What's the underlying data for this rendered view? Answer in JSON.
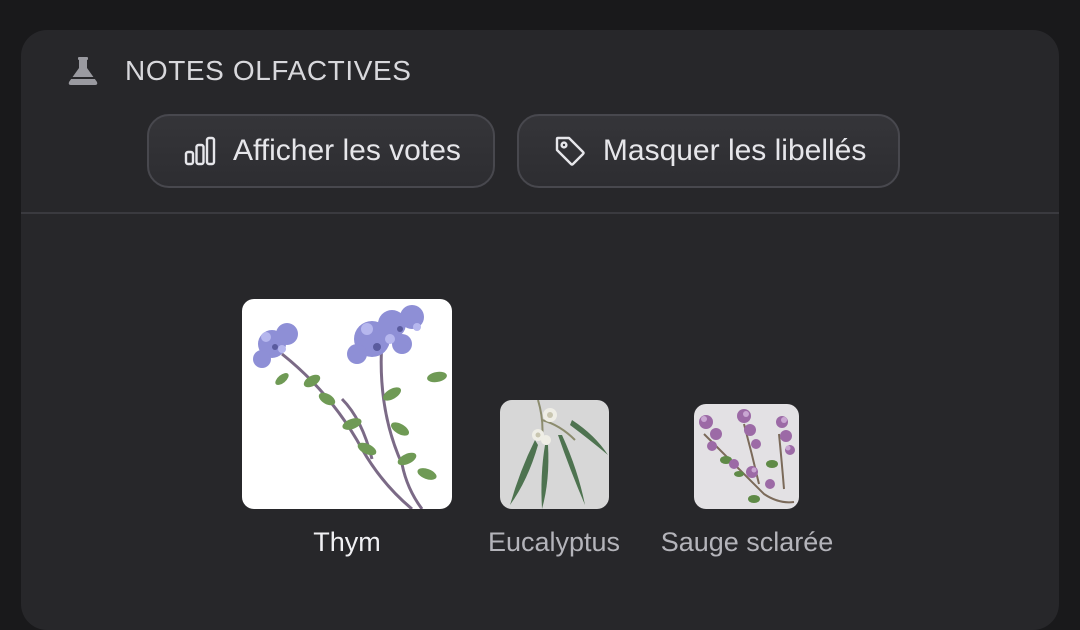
{
  "section": {
    "title": "NOTES OLFACTIVES",
    "icon": "flask-icon"
  },
  "toolbar": {
    "votes_label": "Afficher les votes",
    "votes_icon": "bar-chart-icon",
    "labels_label": "Masquer les libellés",
    "labels_icon": "tag-icon"
  },
  "notes": [
    {
      "label": "Thym",
      "image": "thyme-image",
      "emphasis": "primary"
    },
    {
      "label": "Eucalyptus",
      "image": "eucalyptus-image",
      "emphasis": "secondary"
    },
    {
      "label": "Sauge sclarée",
      "image": "clary-sage-image",
      "emphasis": "secondary"
    }
  ],
  "colors": {
    "background": "#19191b",
    "card": "#27272a",
    "pill_border": "#48484e",
    "text_primary": "#f0f0f3",
    "text_secondary": "#b4b4ba"
  }
}
